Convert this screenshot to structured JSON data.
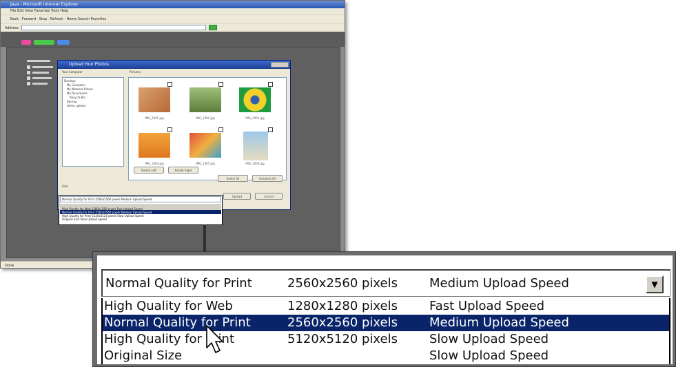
{
  "mini": {
    "window_title": "Java - Microsoft Internet Explorer",
    "menu": "File   Edit   View   Favorites   Tools   Help",
    "toolbar": "Back  ·  Forward  ·  Stop  ·  Refresh  ·  Home        Search    Favorites",
    "address_label": "Address",
    "status": "Done",
    "dialog_title": "Upload Your Photos",
    "section_computer": "Your Computer",
    "section_pictures": "Pictures",
    "tree": [
      "Desktop",
      "My Computer",
      "My Network Places",
      "My Documents",
      "Recycle Bin",
      "Backup",
      "demo_upload"
    ],
    "thumbnails": [
      "IMG_1001.jpg",
      "IMG_1002.jpg",
      "IMG_1003.jpg",
      "IMG_1004.jpg",
      "IMG_1005.jpg",
      "IMG_1006.jpg"
    ],
    "buttons": {
      "rotate_left": "Rotate Left",
      "rotate_right": "Rotate Right",
      "select_all": "Select All",
      "unselect_all": "Unselect All",
      "upload": "Upload",
      "cancel": "Cancel"
    },
    "size_label": "Size",
    "dropdown_field": "Normal Quality for Print   2560x2560 pixels   Medium Upload Speed",
    "dropdown_rows": [
      "High Quality for Web        1280x1280 pixels   Fast Upload Speed",
      "Normal Quality for Print    2560x2560 pixels   Medium Upload Speed",
      "High Quality for Print      5120x5120 pixels   Slow Upload Speed",
      "Original Size                                  Slow Upload Speed"
    ]
  },
  "dropdown": {
    "selected": {
      "quality": "Normal Quality for Print",
      "size": "2560x2560 pixels",
      "speed": "Medium Upload Speed"
    },
    "options": [
      {
        "quality": "High Quality for Web",
        "size": "1280x1280 pixels",
        "speed": "Fast Upload Speed"
      },
      {
        "quality": "Normal Quality for Print",
        "size": "2560x2560 pixels",
        "speed": "Medium Upload Speed"
      },
      {
        "quality": "High Quality for Print",
        "size": "5120x5120 pixels",
        "speed": "Slow Upload Speed"
      },
      {
        "quality": "Original Size",
        "size": "",
        "speed": "Slow Upload Speed"
      }
    ],
    "highlighted_index": 1,
    "arrow_icon": "▼",
    "colors": {
      "highlight": "#0a246a",
      "highlight_text": "#ffffff"
    }
  }
}
